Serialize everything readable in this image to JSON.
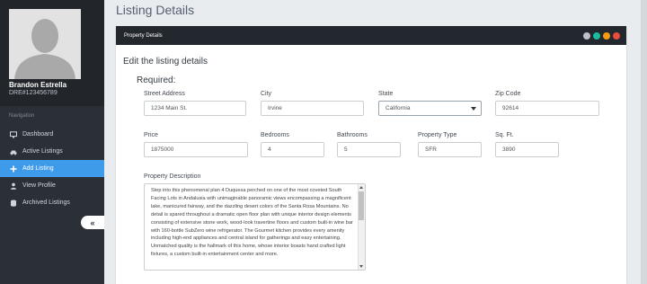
{
  "profile": {
    "name": "Brandon Estrella",
    "license_id": "DRE#123456789"
  },
  "nav": {
    "section_label": "Navigation",
    "items": [
      {
        "label": "Dashboard",
        "icon": "monitor-icon",
        "active": false
      },
      {
        "label": "Active Listings",
        "icon": "car-icon",
        "active": false
      },
      {
        "label": "Add Listing",
        "icon": "plus-icon",
        "active": true
      },
      {
        "label": "View Profile",
        "icon": "user-icon",
        "active": false
      },
      {
        "label": "Archived Listings",
        "icon": "database-icon",
        "active": false
      }
    ],
    "collapse_glyph": "«"
  },
  "page": {
    "title": "Listing Details"
  },
  "panel": {
    "header": "Property Details",
    "header_button_colors": [
      "#b9c3c9",
      "#1abc9c",
      "#f39c12",
      "#e74c3c"
    ],
    "subtitle": "Edit the listing details",
    "required_label": "Required:"
  },
  "form": {
    "street": {
      "label": "Street Address",
      "value": "1234 Main St."
    },
    "city": {
      "label": "City",
      "value": "Irvine"
    },
    "state": {
      "label": "State",
      "value": "California"
    },
    "zip": {
      "label": "Zip Code",
      "value": "92614"
    },
    "price": {
      "label": "Price",
      "value": "1875000"
    },
    "bedrooms": {
      "label": "Bedrooms",
      "value": "4"
    },
    "bathrooms": {
      "label": "Bathrooms",
      "value": "5"
    },
    "property_type": {
      "label": "Property Type",
      "value": "SFR"
    },
    "sqft": {
      "label": "Sq. Ft.",
      "value": "3890"
    },
    "description": {
      "label": "Property Description",
      "value": "Step into this phenomenal plan 4 Duquesa perched on one of the most coveted South Facing Lots in Andalusia with unimaginable panoramic views encompassing a magnificent lake, manicured fairway, and the dazzling desert colors of the Santa Rosa Mountains. No detail is spared throughout a dramatic open floor plan with unique interior design elements consisting of extensive stone work, wood-look travertine floors and custom built-in wine bar with 160-bottle SubZero wine refrigerator. The Gourmet kitchen provides every amenity including high-end appliances and central island for gatherings and easy entertaining. Unmatched quality is the hallmark of this home, whose interior boasts hand crafted light fixtures, a custom built-in entertainment center and more."
    }
  }
}
